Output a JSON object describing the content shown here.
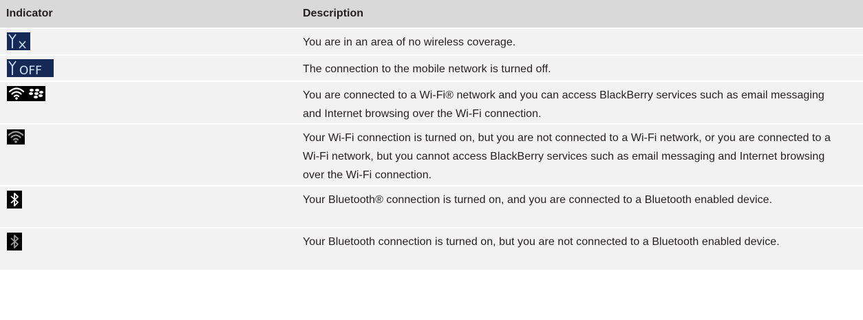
{
  "table": {
    "headers": {
      "indicator": "Indicator",
      "description": "Description"
    },
    "rows": [
      {
        "icon": "no-coverage-antenna-x-icon",
        "description": "You are in an area of no wireless coverage."
      },
      {
        "icon": "antenna-off-icon",
        "description": "The connection to the mobile network is turned off."
      },
      {
        "icon": "wifi-blackberry-connected-icon",
        "description": "You are connected to a Wi-Fi® network and you can access BlackBerry services such as email messaging and Internet browsing over the Wi-Fi connection."
      },
      {
        "icon": "wifi-on-no-services-icon",
        "description": "Your Wi-Fi connection is turned on, but you are not connected to a Wi-Fi network, or you are connected to a Wi-Fi network, but you cannot access BlackBerry services such as email messaging and Internet browsing over the Wi-Fi connection."
      },
      {
        "icon": "bluetooth-connected-icon",
        "description": "Your Bluetooth® connection is turned on, and you are connected to a Bluetooth enabled device."
      },
      {
        "icon": "bluetooth-on-not-connected-icon",
        "description": "Your Bluetooth connection is turned on, but you are not connected to a Bluetooth enabled device."
      }
    ]
  }
}
